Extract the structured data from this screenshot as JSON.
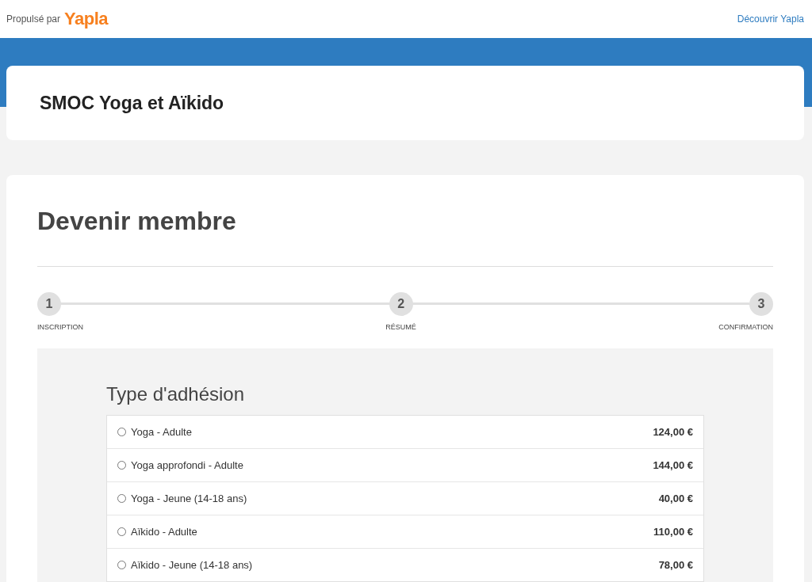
{
  "topbar": {
    "powered_by": "Propulsé par",
    "logo": "Yapla",
    "link": "Découvrir Yapla"
  },
  "organization": {
    "name": "SMOC Yoga et Aïkido"
  },
  "form": {
    "title": "Devenir membre",
    "steps": [
      {
        "number": "1",
        "label": "INSCRIPTION",
        "selected": false
      },
      {
        "number": "2",
        "label": "RÉSUMÉ",
        "selected": false
      },
      {
        "number": "3",
        "label": "CONFIRMATION",
        "selected": false
      }
    ],
    "section_title": "Type d'adhésion",
    "options": [
      {
        "label": "Yoga - Adulte",
        "price": "124,00 €",
        "selected": false
      },
      {
        "label": "Yoga approfondi - Adulte",
        "price": "144,00 €",
        "selected": false
      },
      {
        "label": "Yoga - Jeune (14-18 ans)",
        "price": "40,00 €",
        "selected": false
      },
      {
        "label": "Aïkido - Adulte",
        "price": "110,00 €",
        "selected": false
      },
      {
        "label": "Aïkido - Jeune (14-18 ans)",
        "price": "78,00 €",
        "selected": false
      }
    ]
  }
}
